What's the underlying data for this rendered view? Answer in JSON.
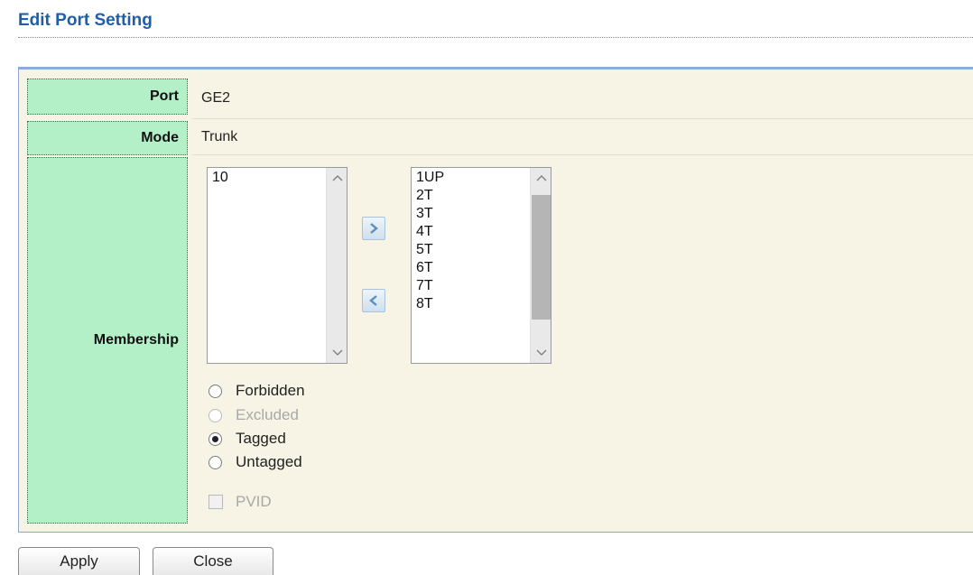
{
  "header": {
    "title": "Edit Port Setting"
  },
  "form": {
    "port": {
      "label": "Port",
      "value": "GE2"
    },
    "mode": {
      "label": "Mode",
      "value": "Trunk"
    },
    "membership": {
      "label": "Membership",
      "available_vlans": [
        "10"
      ],
      "selected_vlans": [
        "1UP",
        "2T",
        "3T",
        "4T",
        "5T",
        "6T",
        "7T",
        "8T"
      ],
      "add_icon": "chevron-right-icon",
      "remove_icon": "chevron-left-icon",
      "radios": [
        {
          "label": "Forbidden",
          "checked": false,
          "disabled": false
        },
        {
          "label": "Excluded",
          "checked": false,
          "disabled": true
        },
        {
          "label": "Tagged",
          "checked": true,
          "disabled": false
        },
        {
          "label": "Untagged",
          "checked": false,
          "disabled": false
        }
      ],
      "pvid": {
        "label": "PVID",
        "checked": false,
        "disabled": true
      }
    }
  },
  "buttons": {
    "apply": "Apply",
    "close": "Close"
  },
  "colors": {
    "title": "#1f5fa8",
    "label_bg": "#b3f0c8",
    "panel_bg": "#f7f4e6",
    "panel_border": "#8aaed6"
  }
}
